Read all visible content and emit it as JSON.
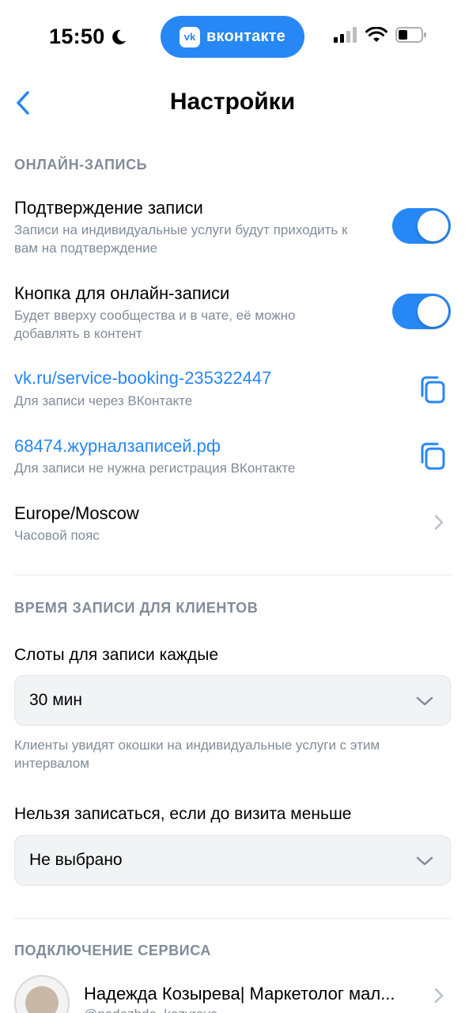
{
  "status_bar": {
    "time": "15:50",
    "app_pill_label": "вконтакте",
    "vk_logo_text": "vk"
  },
  "header": {
    "title": "Настройки"
  },
  "online_booking": {
    "section_title": "ОНЛАЙН-ЗАПИСЬ",
    "confirmation": {
      "title": "Подтверждение записи",
      "subtitle": "Записи на индивидуальные услуги будут приходить к вам на подтверждение",
      "enabled": true
    },
    "booking_button": {
      "title": "Кнопка для онлайн-записи",
      "subtitle": "Будет вверху сообщества и в чате, её можно добавлять в контент",
      "enabled": true
    },
    "vk_link": {
      "url": "vk.ru/service-booking-235322447",
      "subtitle": "Для записи через ВКонтакте"
    },
    "journal_link": {
      "url": "68474.журналзаписей.рф",
      "subtitle": "Для записи не нужна регистрация ВКонтакте"
    },
    "timezone": {
      "value": "Europe/Moscow",
      "subtitle": "Часовой пояс"
    }
  },
  "booking_time": {
    "section_title": "ВРЕМЯ ЗАПИСИ ДЛЯ КЛИЕНТОВ",
    "slots": {
      "label": "Слоты для записи каждые",
      "value": "30 мин",
      "hint": "Клиенты увидят окошки на индивидуальные услуги с этим интервалом"
    },
    "min_lead": {
      "label": "Нельзя записаться, если до визита меньше",
      "value": "Не выбрано"
    }
  },
  "service_connection": {
    "section_title": "ПОДКЛЮЧЕНИЕ СЕРВИСА",
    "name": "Надежда Козырева| Маркетолог мал...",
    "handle": "@nadezhda_kozyreva"
  },
  "colors": {
    "accent": "#2787F5",
    "secondary_text": "#818C99",
    "select_bg": "#F2F3F5"
  }
}
